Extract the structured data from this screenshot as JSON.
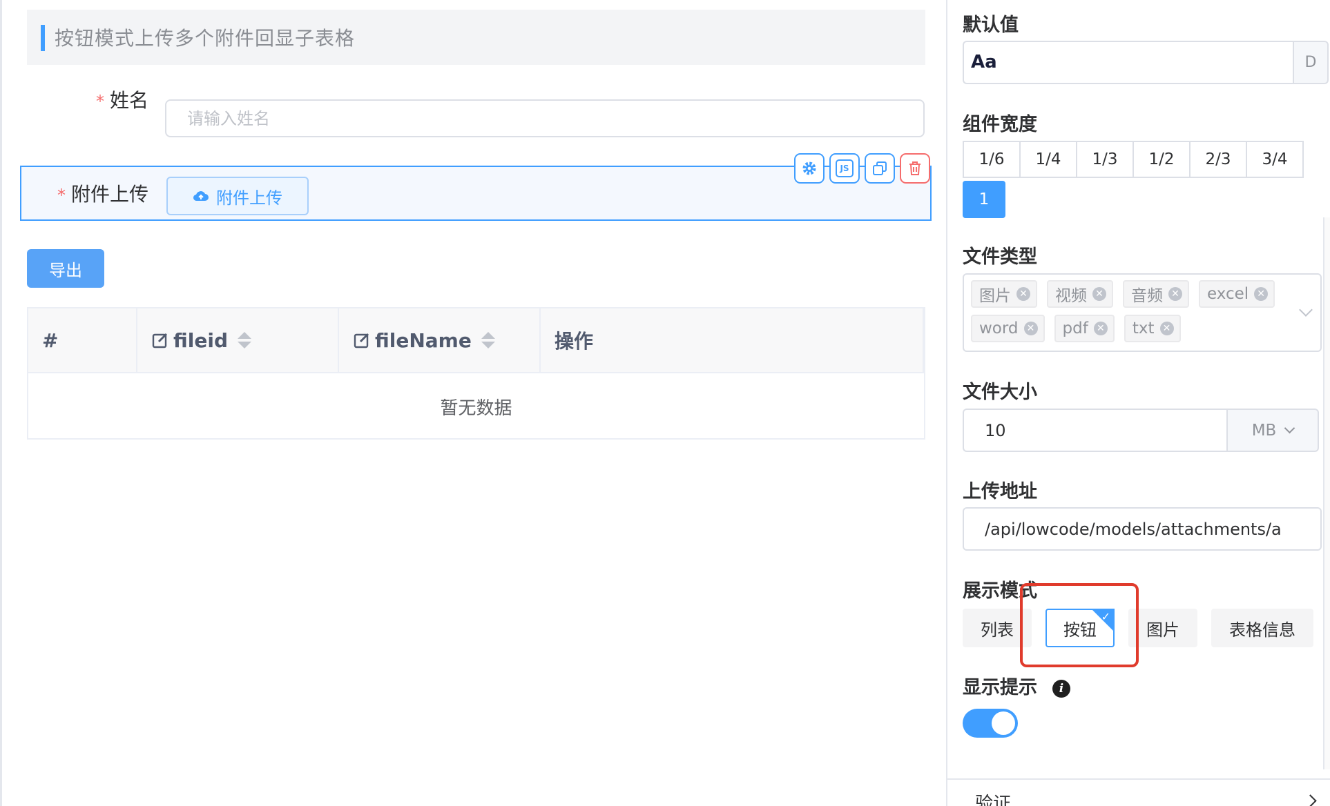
{
  "canvas": {
    "section_title": "按钮模式上传多个附件回显子表格",
    "name_field": {
      "label": "姓名",
      "placeholder": "请输入姓名",
      "required_mark": "*"
    },
    "upload_field": {
      "label": "附件上传",
      "button_label": "附件上传",
      "required_mark": "*"
    },
    "toolbar_icons": [
      "gear-icon",
      "js-icon",
      "copy-icon",
      "trash-icon"
    ],
    "toolbar_js_label": "JS",
    "export_button": "导出",
    "table": {
      "columns": [
        "#",
        "fileid",
        "fileName",
        "操作"
      ],
      "empty_text": "暂无数据"
    }
  },
  "panel": {
    "default_value": {
      "label": "默认值",
      "value": "Aa",
      "suffix": "D"
    },
    "component_width": {
      "label": "组件宽度",
      "options": [
        "1/6",
        "1/4",
        "1/3",
        "1/2",
        "2/3",
        "3/4",
        "1"
      ],
      "selected": "1"
    },
    "file_type": {
      "label": "文件类型",
      "tags": [
        "图片",
        "视频",
        "音频",
        "excel",
        "word",
        "pdf",
        "txt"
      ]
    },
    "file_size": {
      "label": "文件大小",
      "value": "10",
      "unit": "MB"
    },
    "upload_url": {
      "label": "上传地址",
      "value": "/api/lowcode/models/attachments/a"
    },
    "display_mode": {
      "label": "展示模式",
      "options": [
        "列表",
        "按钮",
        "图片",
        "表格信息"
      ],
      "selected": "按钮"
    },
    "show_tip": {
      "label": "显示提示",
      "enabled": true
    },
    "validate_section": "验证"
  },
  "colors": {
    "accent": "#409eff",
    "danger": "#f56c6c",
    "highlight": "#e03b2c"
  }
}
